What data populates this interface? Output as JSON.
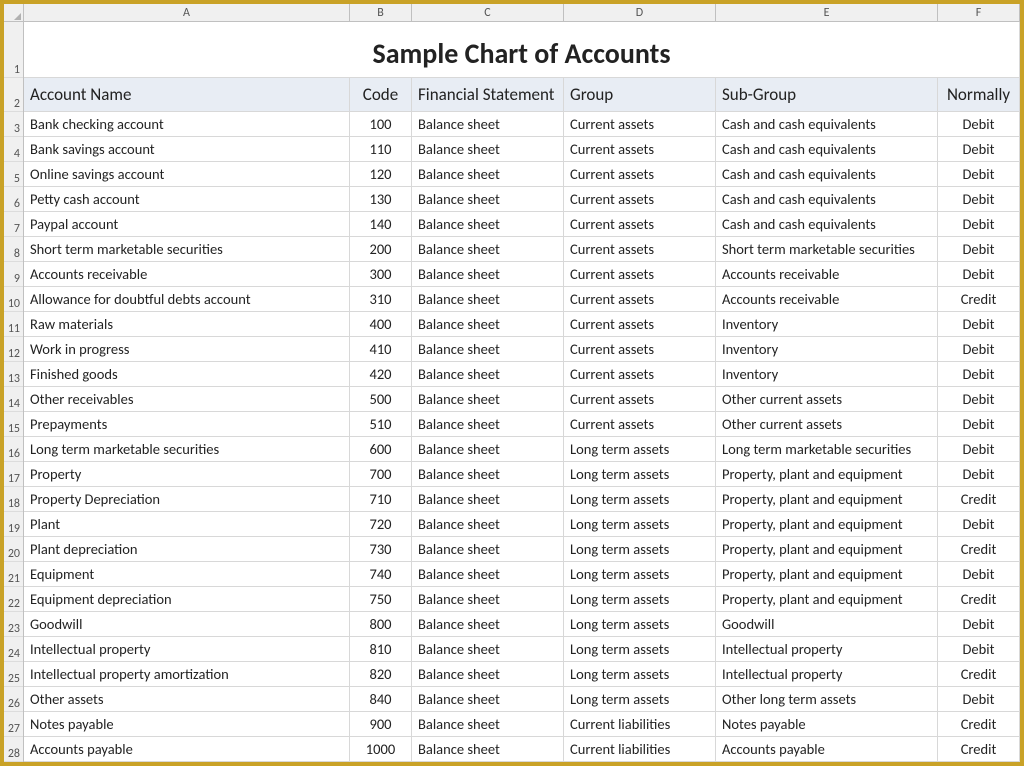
{
  "columns": [
    "A",
    "B",
    "C",
    "D",
    "E",
    "F"
  ],
  "title": "Sample Chart of Accounts",
  "headers": {
    "name": "Account Name",
    "code": "Code",
    "statement": "Financial Statement",
    "group": "Group",
    "subgroup": "Sub-Group",
    "normally": "Normally"
  },
  "row_numbers": [
    1,
    2,
    3,
    4,
    5,
    6,
    7,
    8,
    9,
    10,
    11,
    12,
    13,
    14,
    15,
    16,
    17,
    18,
    19,
    20,
    21,
    22,
    23,
    24,
    25,
    26,
    27,
    28
  ],
  "rows": [
    {
      "name": "Bank checking account",
      "code": "100",
      "statement": "Balance sheet",
      "group": "Current assets",
      "subgroup": "Cash and cash equivalents",
      "normally": "Debit"
    },
    {
      "name": "Bank savings account",
      "code": "110",
      "statement": "Balance sheet",
      "group": "Current assets",
      "subgroup": "Cash and cash equivalents",
      "normally": "Debit"
    },
    {
      "name": "Online savings account",
      "code": "120",
      "statement": "Balance sheet",
      "group": "Current assets",
      "subgroup": "Cash and cash equivalents",
      "normally": "Debit"
    },
    {
      "name": "Petty cash account",
      "code": "130",
      "statement": "Balance sheet",
      "group": "Current assets",
      "subgroup": "Cash and cash equivalents",
      "normally": "Debit"
    },
    {
      "name": "Paypal account",
      "code": "140",
      "statement": "Balance sheet",
      "group": "Current assets",
      "subgroup": "Cash and cash equivalents",
      "normally": "Debit"
    },
    {
      "name": "Short term marketable securities",
      "code": "200",
      "statement": "Balance sheet",
      "group": "Current assets",
      "subgroup": "Short term marketable securities",
      "normally": "Debit"
    },
    {
      "name": "Accounts receivable",
      "code": "300",
      "statement": "Balance sheet",
      "group": "Current assets",
      "subgroup": "Accounts receivable",
      "normally": "Debit"
    },
    {
      "name": "Allowance for doubtful debts account",
      "code": "310",
      "statement": "Balance sheet",
      "group": "Current assets",
      "subgroup": "Accounts receivable",
      "normally": "Credit"
    },
    {
      "name": "Raw materials",
      "code": "400",
      "statement": "Balance sheet",
      "group": "Current assets",
      "subgroup": "Inventory",
      "normally": "Debit"
    },
    {
      "name": "Work in progress",
      "code": "410",
      "statement": "Balance sheet",
      "group": "Current assets",
      "subgroup": "Inventory",
      "normally": "Debit"
    },
    {
      "name": "Finished goods",
      "code": "420",
      "statement": "Balance sheet",
      "group": "Current assets",
      "subgroup": "Inventory",
      "normally": "Debit"
    },
    {
      "name": "Other receivables",
      "code": "500",
      "statement": "Balance sheet",
      "group": "Current assets",
      "subgroup": "Other current assets",
      "normally": "Debit"
    },
    {
      "name": "Prepayments",
      "code": "510",
      "statement": "Balance sheet",
      "group": "Current assets",
      "subgroup": "Other current assets",
      "normally": "Debit"
    },
    {
      "name": "Long term marketable securities",
      "code": "600",
      "statement": "Balance sheet",
      "group": "Long term assets",
      "subgroup": "Long term marketable securities",
      "normally": "Debit"
    },
    {
      "name": "Property",
      "code": "700",
      "statement": "Balance sheet",
      "group": "Long term assets",
      "subgroup": "Property, plant and equipment",
      "normally": "Debit"
    },
    {
      "name": "Property Depreciation",
      "code": "710",
      "statement": "Balance sheet",
      "group": "Long term assets",
      "subgroup": "Property, plant and equipment",
      "normally": "Credit"
    },
    {
      "name": "Plant",
      "code": "720",
      "statement": "Balance sheet",
      "group": "Long term assets",
      "subgroup": "Property, plant and equipment",
      "normally": "Debit"
    },
    {
      "name": "Plant depreciation",
      "code": "730",
      "statement": "Balance sheet",
      "group": "Long term assets",
      "subgroup": "Property, plant and equipment",
      "normally": "Credit"
    },
    {
      "name": "Equipment",
      "code": "740",
      "statement": "Balance sheet",
      "group": "Long term assets",
      "subgroup": "Property, plant and equipment",
      "normally": "Debit"
    },
    {
      "name": "Equipment depreciation",
      "code": "750",
      "statement": "Balance sheet",
      "group": "Long term assets",
      "subgroup": "Property, plant and equipment",
      "normally": "Credit"
    },
    {
      "name": "Goodwill",
      "code": "800",
      "statement": "Balance sheet",
      "group": "Long term assets",
      "subgroup": "Goodwill",
      "normally": "Debit"
    },
    {
      "name": "Intellectual property",
      "code": "810",
      "statement": "Balance sheet",
      "group": "Long term assets",
      "subgroup": "Intellectual property",
      "normally": "Debit"
    },
    {
      "name": "Intellectual property amortization",
      "code": "820",
      "statement": "Balance sheet",
      "group": "Long term assets",
      "subgroup": "Intellectual property",
      "normally": "Credit"
    },
    {
      "name": "Other assets",
      "code": "840",
      "statement": "Balance sheet",
      "group": "Long term assets",
      "subgroup": "Other long term assets",
      "normally": "Debit"
    },
    {
      "name": "Notes payable",
      "code": "900",
      "statement": "Balance sheet",
      "group": "Current liabilities",
      "subgroup": "Notes payable",
      "normally": "Credit"
    },
    {
      "name": "Accounts payable",
      "code": "1000",
      "statement": "Balance sheet",
      "group": "Current liabilities",
      "subgroup": "Accounts payable",
      "normally": "Credit"
    }
  ],
  "heights": {
    "title": 56,
    "header": 34,
    "row": 25
  }
}
